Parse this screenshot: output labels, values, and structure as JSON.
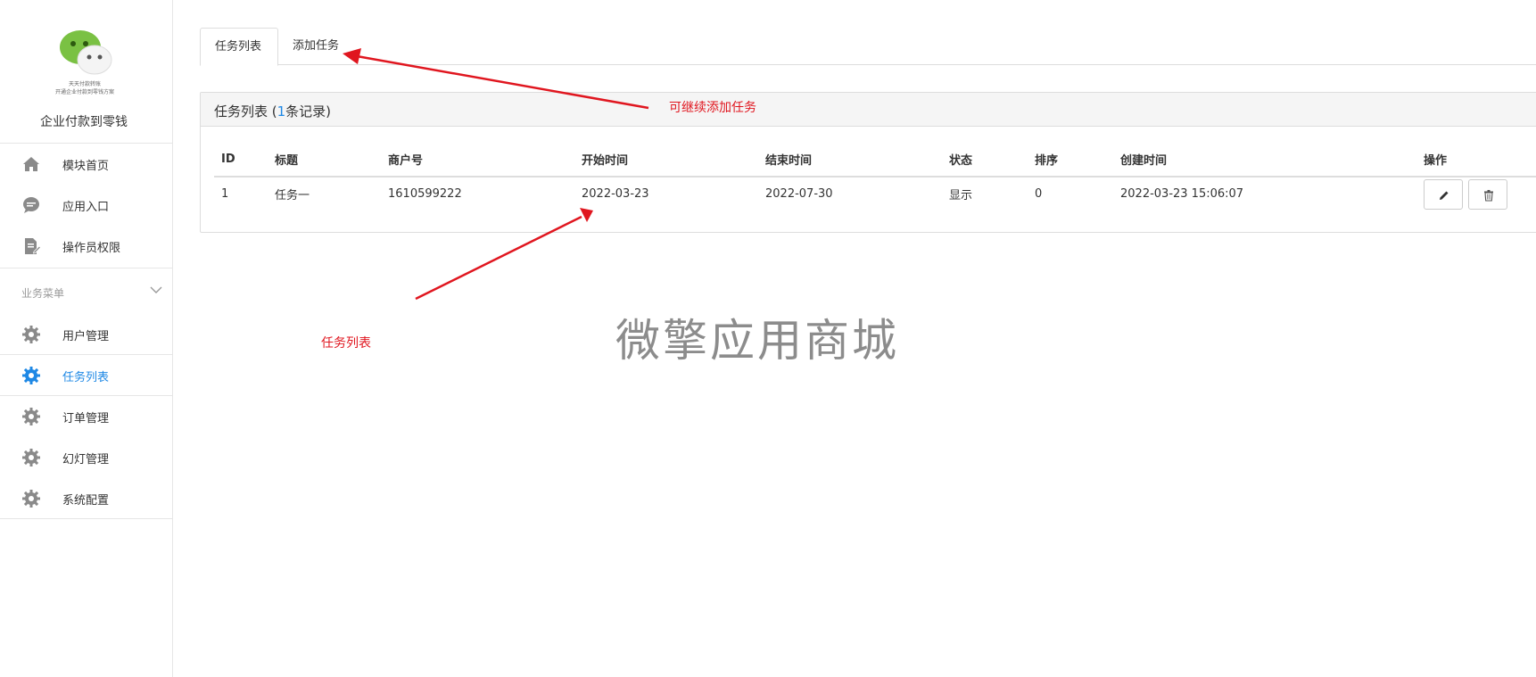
{
  "sidebar": {
    "logo_tagline_1": "天天付款转账",
    "logo_tagline_2": "开通企业付款到零钱方案",
    "app_name": "企业付款到零钱",
    "top_items": [
      {
        "label": "模块首页",
        "icon": "home-icon"
      },
      {
        "label": "应用入口",
        "icon": "chat-icon"
      },
      {
        "label": "操作员权限",
        "icon": "document-edit-icon"
      }
    ],
    "group_label": "业务菜单",
    "group_items": [
      {
        "label": "用户管理",
        "icon": "gear-icon",
        "active": false
      },
      {
        "label": "任务列表",
        "icon": "gear-icon",
        "active": true
      },
      {
        "label": "订单管理",
        "icon": "gear-icon",
        "active": false
      },
      {
        "label": "幻灯管理",
        "icon": "gear-icon",
        "active": false
      },
      {
        "label": "系统配置",
        "icon": "gear-icon",
        "active": false
      }
    ]
  },
  "tabs": [
    {
      "label": "任务列表",
      "active": true
    },
    {
      "label": "添加任务",
      "active": false
    }
  ],
  "panel": {
    "title_prefix": "任务列表 (",
    "count": "1",
    "title_suffix": "条记录)"
  },
  "table": {
    "headers": [
      "ID",
      "标题",
      "商户号",
      "开始时间",
      "结束时间",
      "状态",
      "排序",
      "创建时间",
      "操作"
    ],
    "rows": [
      {
        "id": "1",
        "title": "任务一",
        "merchant": "1610599222",
        "start": "2022-03-23",
        "end": "2022-07-30",
        "status": "显示",
        "sort": "0",
        "created": "2022-03-23 15:06:07"
      }
    ]
  },
  "annotations": {
    "add_note": "可继续添加任务",
    "list_note": "任务列表"
  },
  "watermark": "微擎应用商城",
  "colors": {
    "accent": "#1e88e5",
    "annotation": "#e0161f",
    "logo_green": "#7ac143"
  }
}
